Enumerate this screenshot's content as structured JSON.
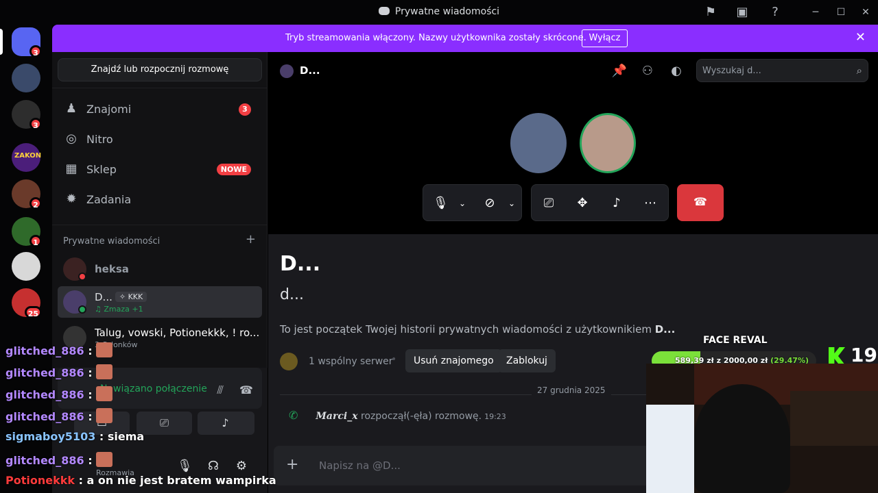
{
  "titlebar": {
    "title": "Prywatne wiadomości",
    "icons": [
      "flag-icon",
      "inbox-icon",
      "help-icon"
    ],
    "window_controls": [
      "minimize",
      "maximize",
      "close"
    ]
  },
  "guilds": [
    {
      "name": "home-discord",
      "badge": "3",
      "color": "#5865f2"
    },
    {
      "name": "server-2",
      "badge": "",
      "color": "#3a4a6a"
    },
    {
      "name": "server-3",
      "badge": "3",
      "color": "#2d2d2d"
    },
    {
      "name": "server-zakon",
      "badge": "",
      "color": "#4b1e7a",
      "label": "ZAKON"
    },
    {
      "name": "server-5",
      "badge": "2",
      "color": "#6a3a2a"
    },
    {
      "name": "server-6",
      "badge": "1",
      "color": "#2f6a2a"
    },
    {
      "name": "server-7",
      "badge": "",
      "color": "#d8d8d8"
    },
    {
      "name": "server-8",
      "badge": "25",
      "color": "#c63030"
    }
  ],
  "banner": {
    "text": "Tryb streamowania włączony. Nazwy użytkownika zostały skrócone.",
    "button": "Wyłącz"
  },
  "sidebar": {
    "search_button": "Znajdź lub rozpocznij rozmowę",
    "nav": [
      {
        "label": "Znajomi",
        "badge": "3",
        "icon": "friends-icon"
      },
      {
        "label": "Nitro",
        "badge": "",
        "icon": "nitro-icon"
      },
      {
        "label": "Sklep",
        "badge": "NOWE",
        "icon": "shop-icon"
      },
      {
        "label": "Zadania",
        "badge": "",
        "icon": "quests-icon"
      }
    ],
    "dm_header": "Prywatne wiadomości",
    "dms": [
      {
        "name": "heksa",
        "sub": "",
        "tag": ""
      },
      {
        "name": "D...",
        "sub": "♫ Zmaza +1",
        "tag": "✧ KKK"
      },
      {
        "name": "Talug, vowski, Potionekkk, ! ro...",
        "sub": "3 Członków",
        "tag": ""
      }
    ]
  },
  "userpanel": {
    "connection": "Nawiązano połączenie",
    "status": "Rozmawia"
  },
  "header": {
    "name": "D...",
    "search_placeholder": "Wyszukaj d..."
  },
  "profile": {
    "name": "D...",
    "username": "d...",
    "intro_prefix": "To jest początek Twojej historii prywatnych wiadomości z użytkownikiem ",
    "intro_name": "D...",
    "mutual": "1 wspólny serwer",
    "remove_friend": "Usuń znajomego",
    "block": "Zablokuj"
  },
  "messages": {
    "date": "27 grudnia 2025",
    "call_user": "𝑴𝒂𝒓𝒄𝒊_𝒙",
    "call_text": "rozpoczął(-ęła) rozmowę.",
    "call_time": "19:23"
  },
  "composer": {
    "placeholder": "Napisz na @D..."
  },
  "chat_overlay": [
    {
      "user": "glitched_886",
      "sep": " :",
      "msg": "",
      "emote": true,
      "style": "u"
    },
    {
      "user": "glitched_886",
      "sep": " :",
      "msg": "",
      "emote": true,
      "style": "u"
    },
    {
      "user": "glitched_886",
      "sep": " :",
      "msg": "",
      "emote": true,
      "style": "u"
    },
    {
      "user": "glitched_886",
      "sep": " :",
      "msg": "",
      "emote": true,
      "style": "u"
    },
    {
      "user": "sigmaboy5103",
      "sep": " :",
      "msg": " siema",
      "emote": false,
      "style": "u2"
    },
    {
      "user": "glitched_886",
      "sep": " :",
      "msg": "",
      "emote": true,
      "style": "u"
    },
    {
      "user": "Potionekkk",
      "sep": " :",
      "msg": " a on nie jest bratem wampirka",
      "emote": false,
      "style": "u3"
    }
  ],
  "stream_overlay": {
    "goal_title": "FACE REVAL",
    "goal_current": "589,39 zł",
    "goal_of": "z",
    "goal_target": "2000,00 zł",
    "goal_percent": "(29.47%)",
    "goal_fraction": 0.2947,
    "viewer_count": "19"
  },
  "colors": {
    "banner": "#8a2eff",
    "hangup": "#da373c",
    "badge": "#f23f43",
    "online": "#23a55a",
    "kick": "#53fc18"
  }
}
